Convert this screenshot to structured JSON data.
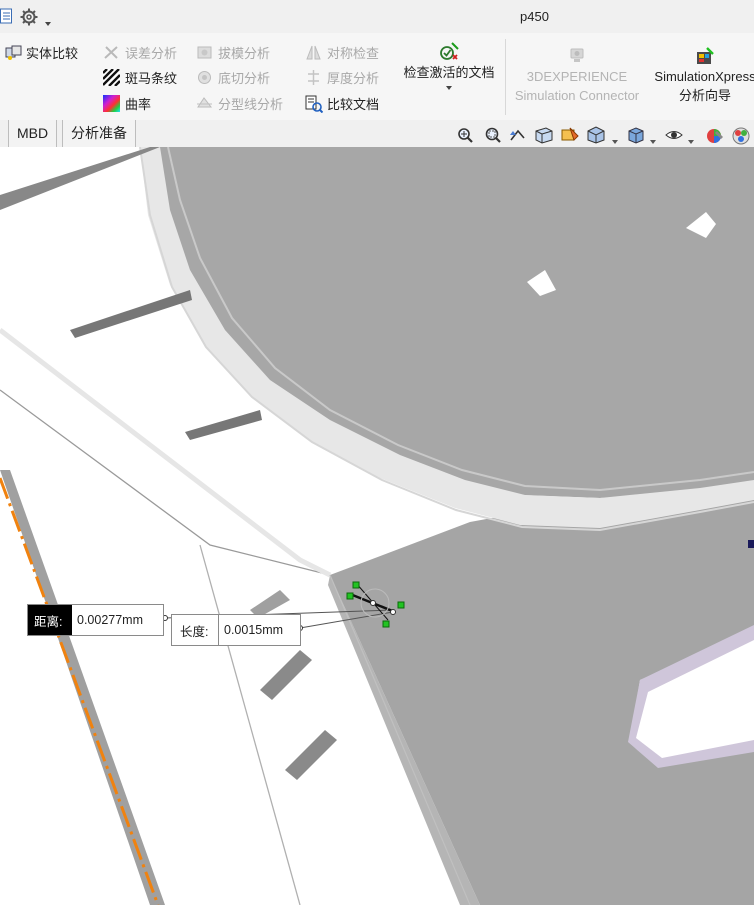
{
  "window": {
    "title": "p450"
  },
  "titlebar_icons": [
    "list-icon",
    "gear-icon",
    "dropdown-arrow-icon"
  ],
  "ribbon": {
    "compare_solids": "实体比较",
    "deviation_analysis": "误差分析",
    "zebra_stripes": "斑马条纹",
    "curvature": "曲率",
    "draft_analysis": "拔模分析",
    "undercut_analysis": "底切分析",
    "parting_line_analysis": "分型线分析",
    "symmetry_check": "对称检查",
    "thickness_analysis": "厚度分析",
    "compare_documents": "比较文档",
    "check_active_document": "检查激活的文档",
    "experience_line1": "3DEXPERIENCE",
    "experience_line2": "Simulation Connector",
    "simxpress_line1": "SimulationXpress",
    "simxpress_line2": "分析向导"
  },
  "tabs": [
    "MBD",
    "分析准备"
  ],
  "measure": {
    "distance_label": "距离:",
    "distance_value": "0.00277mm",
    "length_label": "长度:",
    "length_value": "0.0015mm"
  },
  "colors": {
    "accent_orange": "#f0820f",
    "model_gray": "#a7a7a7",
    "point_green": "#22c322"
  }
}
